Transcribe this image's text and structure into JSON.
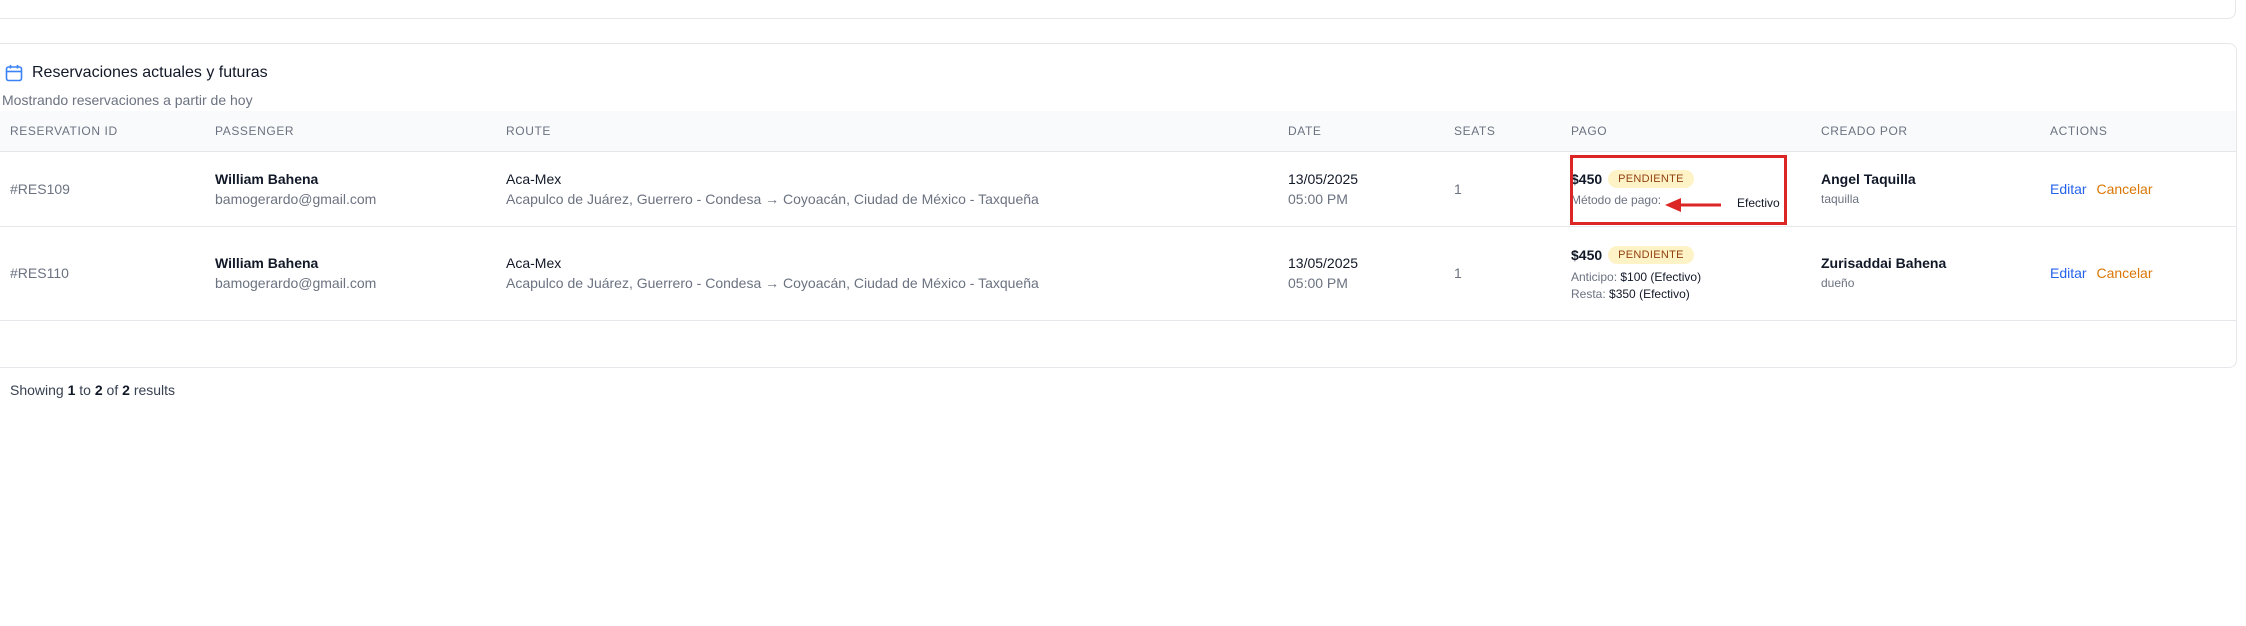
{
  "section": {
    "title": "Reservaciones actuales y futuras",
    "subtitle": "Mostrando reservaciones a partir de hoy",
    "icon": "calendar-icon"
  },
  "table": {
    "headers": {
      "id": "RESERVATION ID",
      "passenger": "PASSENGER",
      "route": "ROUTE",
      "date": "DATE",
      "seats": "SEATS",
      "pago": "PAGO",
      "creado": "CREADO POR",
      "actions": "ACTIONS"
    },
    "rows": [
      {
        "id": "#RES109",
        "passenger_name": "William Bahena",
        "passenger_email": "bamogerardo@gmail.com",
        "route_name": "Aca-Mex",
        "route_detail": "Acapulco de Juárez, Guerrero - Condesa → Coyoacán, Ciudad de México - Taxqueña",
        "date": "13/05/2025",
        "time": "05:00 PM",
        "seats": "1",
        "amount": "$450",
        "status": "PENDIENTE",
        "payment_label": "Método de pago:",
        "payment_value": "Efectivo",
        "creator_name": "Angel Taquilla",
        "creator_role": "taquilla",
        "edit_label": "Editar",
        "cancel_label": "Cancelar"
      },
      {
        "id": "#RES110",
        "passenger_name": "William Bahena",
        "passenger_email": "bamogerardo@gmail.com",
        "route_name": "Aca-Mex",
        "route_detail": "Acapulco de Juárez, Guerrero - Condesa → Coyoacán, Ciudad de México - Taxqueña",
        "date": "13/05/2025",
        "time": "05:00 PM",
        "seats": "1",
        "amount": "$450",
        "status": "PENDIENTE",
        "anticipo_label": "Anticipo:",
        "anticipo_value": "$100",
        "anticipo_method": "(Efectivo)",
        "resta_label": "Resta:",
        "resta_value": "$350",
        "resta_method": "(Efectivo)",
        "creator_name": "Zurisaddai Bahena",
        "creator_role": "dueño",
        "edit_label": "Editar",
        "cancel_label": "Cancelar"
      }
    ]
  },
  "footer": {
    "prefix": "Showing",
    "from": "1",
    "to_word": "to",
    "to": "2",
    "of_word": "of",
    "total": "2",
    "suffix": "results"
  },
  "colors": {
    "highlight": "#dc2626",
    "badge_bg": "#fef3c7",
    "badge_text": "#92400e",
    "edit": "#2563eb",
    "cancel": "#d97706"
  }
}
